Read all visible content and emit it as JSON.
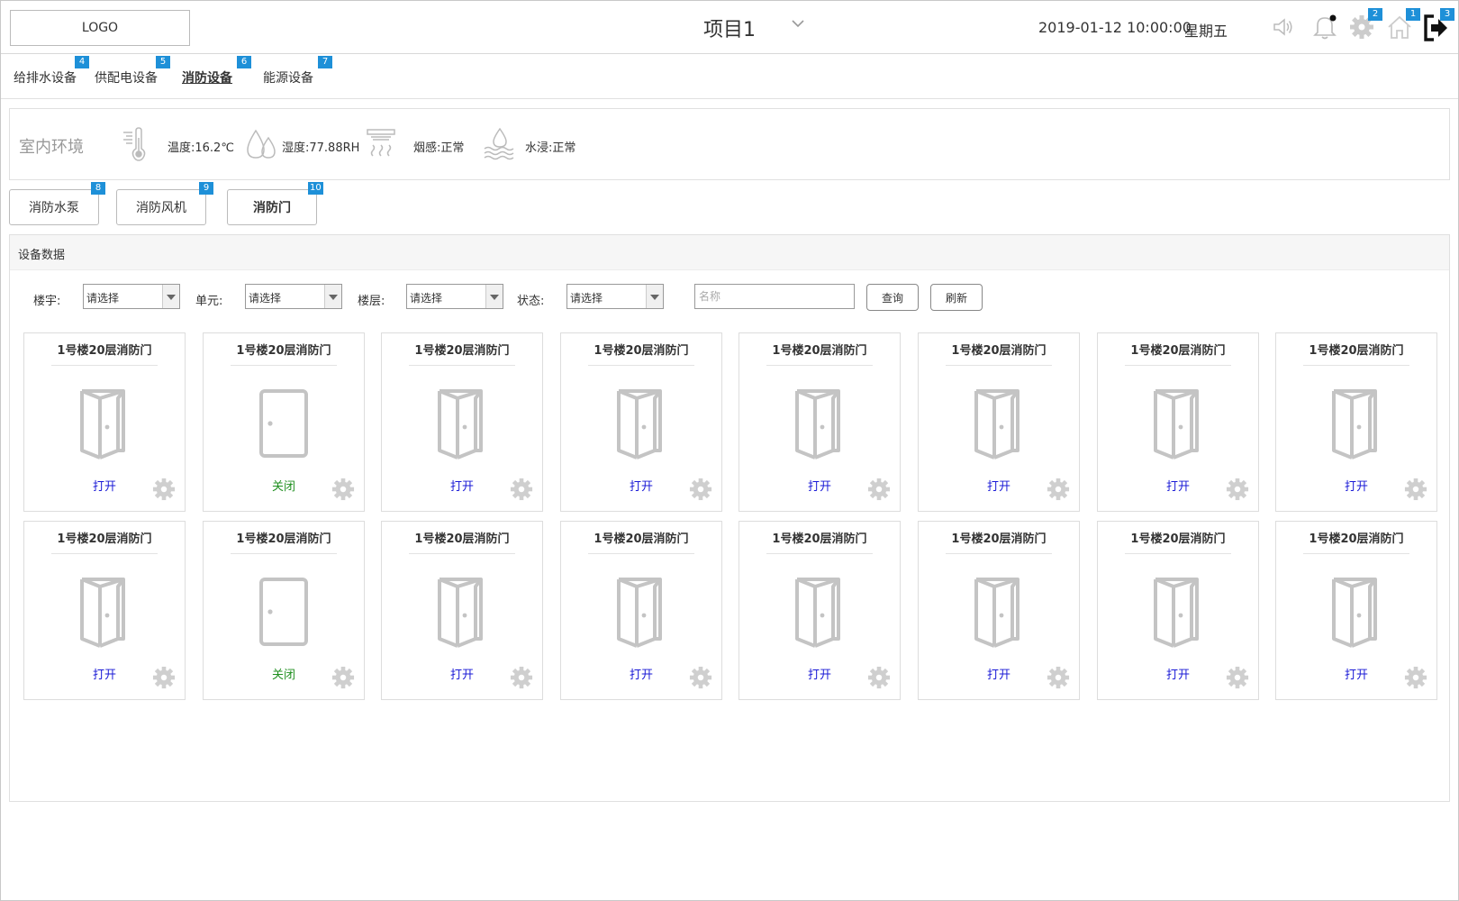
{
  "header": {
    "logo": "LOGO",
    "project": "项目1",
    "datetime": "2019-01-12 10:00:00",
    "weekday": "星期五",
    "icons": [
      "speaker-icon",
      "bell-icon",
      "gear-icon",
      "home-icon",
      "logout-icon"
    ],
    "badges": {
      "settings": "2",
      "home": "1",
      "logout": "3"
    }
  },
  "tabs": [
    {
      "label": "给排水设备",
      "badge": "4"
    },
    {
      "label": "供配电设备",
      "badge": "5"
    },
    {
      "label": "消防设备",
      "badge": "6",
      "active": true
    },
    {
      "label": "能源设备",
      "badge": "7"
    }
  ],
  "environment": {
    "title": "室内环境",
    "temperature": "温度:16.2℃",
    "humidity": "湿度:77.88RH",
    "smoke": "烟感:正常",
    "flood": "水浸:正常"
  },
  "subtabs": [
    {
      "label": "消防水泵",
      "badge": "8"
    },
    {
      "label": "消防风机",
      "badge": "9"
    },
    {
      "label": "消防门",
      "badge": "10",
      "active": true
    }
  ],
  "panel": {
    "title": "设备数据",
    "filters": {
      "building_label": "楼宇:",
      "unit_label": "单元:",
      "floor_label": "楼层:",
      "status_label": "状态:",
      "select_value": "请选择",
      "name_placeholder": "名称",
      "query_label": "查询",
      "refresh_label": "刷新"
    }
  },
  "colors": {
    "open": "#1a1ad6",
    "closed": "#1f8f1f",
    "badge": "#1e90d8"
  },
  "devices": [
    {
      "name": "1号楼20层消防门",
      "status": "打开",
      "state": "open"
    },
    {
      "name": "1号楼20层消防门",
      "status": "关闭",
      "state": "closed"
    },
    {
      "name": "1号楼20层消防门",
      "status": "打开",
      "state": "open"
    },
    {
      "name": "1号楼20层消防门",
      "status": "打开",
      "state": "open"
    },
    {
      "name": "1号楼20层消防门",
      "status": "打开",
      "state": "open"
    },
    {
      "name": "1号楼20层消防门",
      "status": "打开",
      "state": "open"
    },
    {
      "name": "1号楼20层消防门",
      "status": "打开",
      "state": "open"
    },
    {
      "name": "1号楼20层消防门",
      "status": "打开",
      "state": "open"
    },
    {
      "name": "1号楼20层消防门",
      "status": "打开",
      "state": "open"
    },
    {
      "name": "1号楼20层消防门",
      "status": "关闭",
      "state": "closed"
    },
    {
      "name": "1号楼20层消防门",
      "status": "打开",
      "state": "open"
    },
    {
      "name": "1号楼20层消防门",
      "status": "打开",
      "state": "open"
    },
    {
      "name": "1号楼20层消防门",
      "status": "打开",
      "state": "open"
    },
    {
      "name": "1号楼20层消防门",
      "status": "打开",
      "state": "open"
    },
    {
      "name": "1号楼20层消防门",
      "status": "打开",
      "state": "open"
    },
    {
      "name": "1号楼20层消防门",
      "status": "打开",
      "state": "open"
    }
  ]
}
